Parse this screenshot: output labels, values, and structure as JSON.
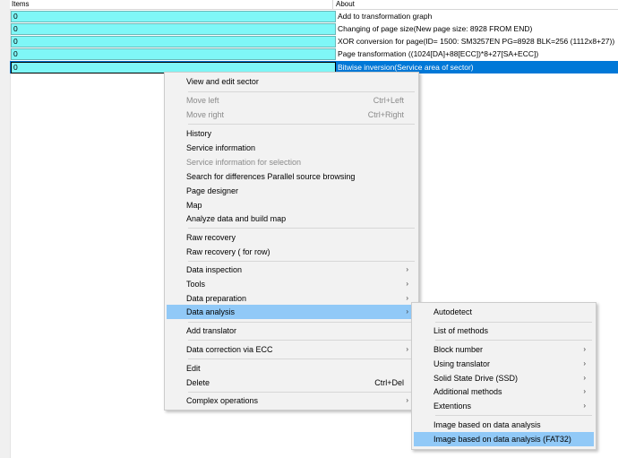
{
  "table": {
    "headers": {
      "items": "Items",
      "about": "About"
    },
    "rows": [
      {
        "value": "0",
        "about": "Add to transformation graph"
      },
      {
        "value": "0",
        "about": "Changing of page size(New page size: 8928  FROM END)"
      },
      {
        "value": "0",
        "about": "XOR conversion for page(ID= 1500: SM3257EN PG=8928 BLK=256 (1112x8+27))"
      },
      {
        "value": "0",
        "about": "Page transformation ((1024[DA]+88[ECC])*8+27[SA+ECC])"
      },
      {
        "value": "0",
        "about": "Bitwise inversion(Service area of sector)"
      }
    ]
  },
  "context_menu": {
    "items": [
      {
        "label": "View and edit sector"
      },
      {
        "label": "Move left",
        "shortcut": "Ctrl+Left",
        "disabled": true
      },
      {
        "label": "Move right",
        "shortcut": "Ctrl+Right",
        "disabled": true
      },
      {
        "label": "History"
      },
      {
        "label": "Service information"
      },
      {
        "label": "Service information for selection",
        "disabled": true
      },
      {
        "label": "Search for differences Parallel source browsing"
      },
      {
        "label": "Page designer"
      },
      {
        "label": "Map"
      },
      {
        "label": "Analyze data and build map"
      },
      {
        "label": "Raw recovery"
      },
      {
        "label": "Raw recovery ( for row)"
      },
      {
        "label": "Data inspection",
        "arrow": "›"
      },
      {
        "label": "Tools",
        "arrow": "›"
      },
      {
        "label": "Data preparation",
        "arrow": "›"
      },
      {
        "label": "Data analysis",
        "arrow": "›",
        "highlighted": true
      },
      {
        "label": "Add translator"
      },
      {
        "label": "Data correction via ECC",
        "arrow": "›"
      },
      {
        "label": "Edit"
      },
      {
        "label": "Delete",
        "shortcut": "Ctrl+Del"
      },
      {
        "label": "Complex operations",
        "arrow": "›"
      }
    ]
  },
  "submenu": {
    "items": [
      {
        "label": "Autodetect"
      },
      {
        "label": "List of methods"
      },
      {
        "label": "Block number",
        "arrow": "›"
      },
      {
        "label": "Using translator",
        "arrow": "›"
      },
      {
        "label": "Solid State Drive (SSD)",
        "arrow": "›"
      },
      {
        "label": "Additional methods",
        "arrow": "›"
      },
      {
        "label": "Extentions",
        "arrow": "›"
      },
      {
        "label": "Image based on data analysis"
      },
      {
        "label": "Image based on data analysis (FAT32)",
        "highlighted": true
      }
    ]
  }
}
